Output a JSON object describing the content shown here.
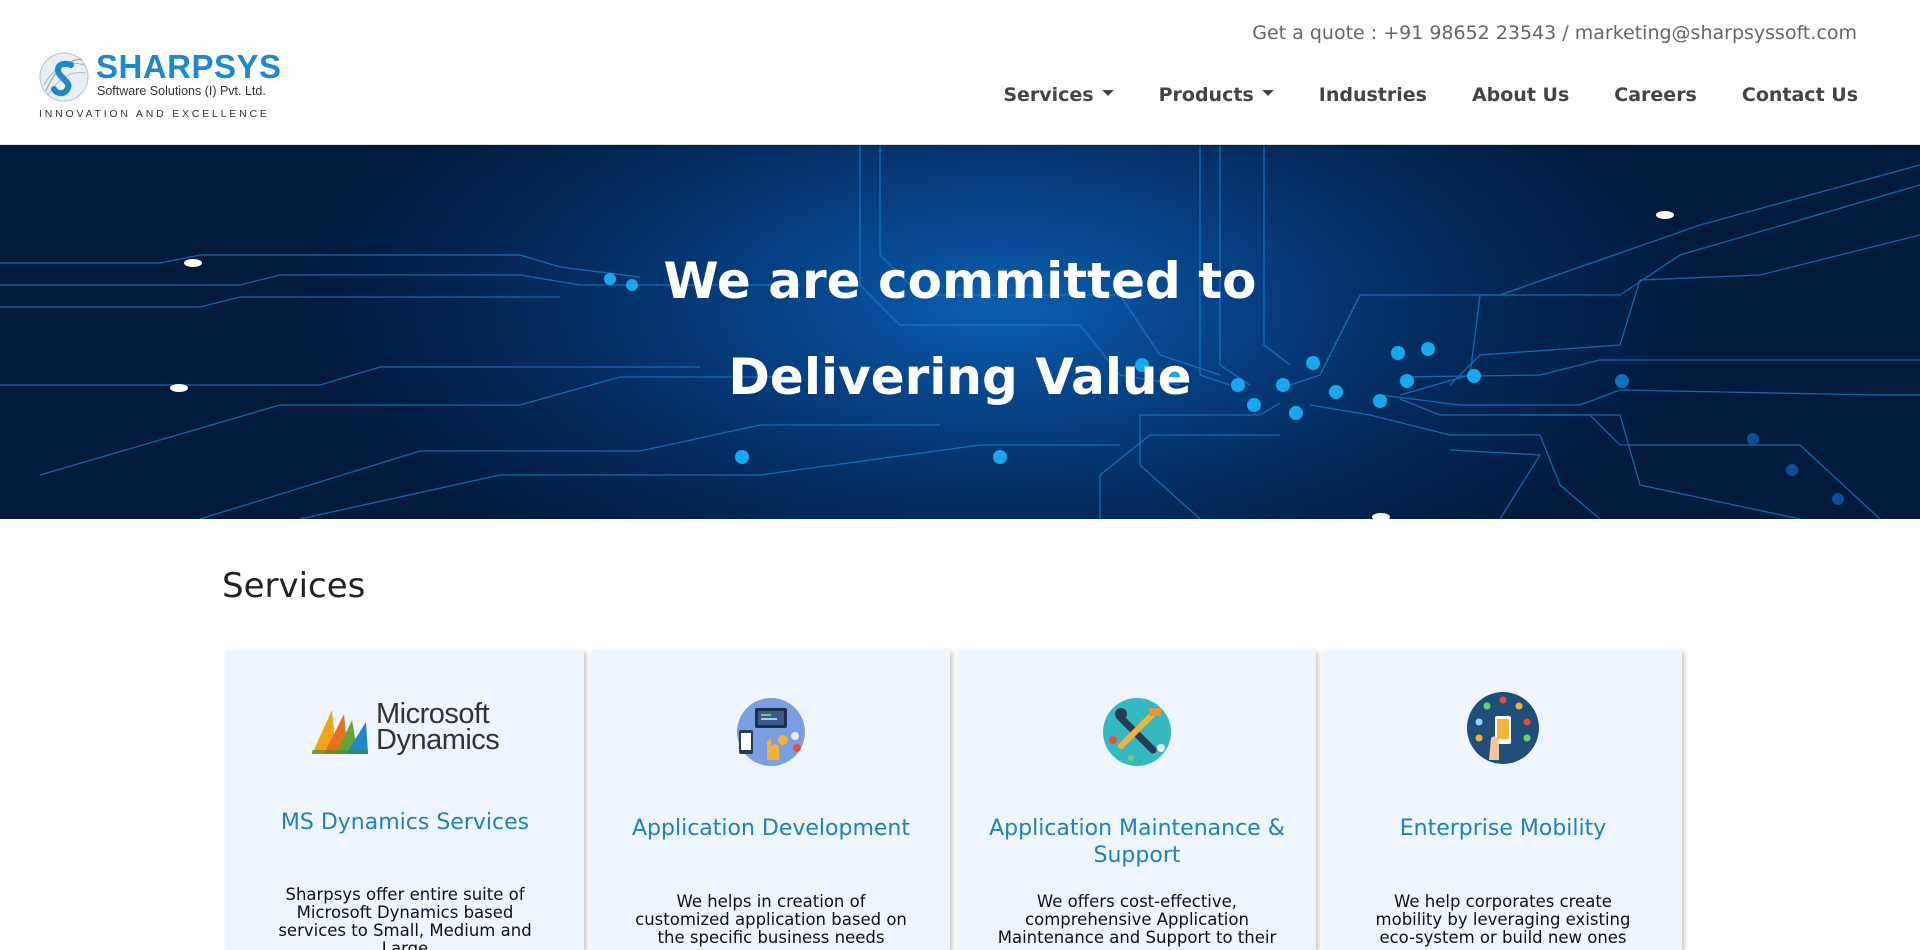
{
  "header": {
    "logo": {
      "name": "SHARPSYS",
      "subtitle": "Software Solutions (I) Pvt. Ltd.",
      "tagline": "INNOVATION AND EXCELLENCE"
    },
    "quote": "Get a quote : +91 98652 23543 / marketing@sharpsyssoft.com",
    "nav": [
      {
        "label": "Services",
        "dropdown": true
      },
      {
        "label": "Products",
        "dropdown": true
      },
      {
        "label": "Industries"
      },
      {
        "label": "About Us"
      },
      {
        "label": "Careers"
      },
      {
        "label": "Contact Us"
      }
    ]
  },
  "hero": {
    "line1": "We are committed to",
    "line2": "Delivering Value"
  },
  "services": {
    "title": "Services",
    "cards": [
      {
        "icon": "microsoft-dynamics-logo",
        "logo_word1": "Microsoft",
        "logo_word2": "Dynamics",
        "title": "MS Dynamics Services",
        "desc": "Sharpsys offer entire suite of Microsoft Dynamics based services to Small, Medium and Large"
      },
      {
        "icon": "app-development-icon",
        "title": "Application Development",
        "desc": "We helps in creation of customized application based on the specific business needs"
      },
      {
        "icon": "maintenance-tools-icon",
        "title": "Application Maintenance & Support",
        "desc": "We offers cost-effective, comprehensive Application Maintenance and Support to their"
      },
      {
        "icon": "mobile-network-icon",
        "title": "Enterprise Mobility",
        "desc": "We help corporates create mobility by leveraging existing eco-system or build new ones"
      }
    ]
  },
  "colors": {
    "brand_blue": "#1e88c8",
    "card_title": "#1f7fc4",
    "card_bg": "#eef5fc",
    "hero_dark": "#021a3c",
    "hero_mid": "#0a5fb0"
  }
}
